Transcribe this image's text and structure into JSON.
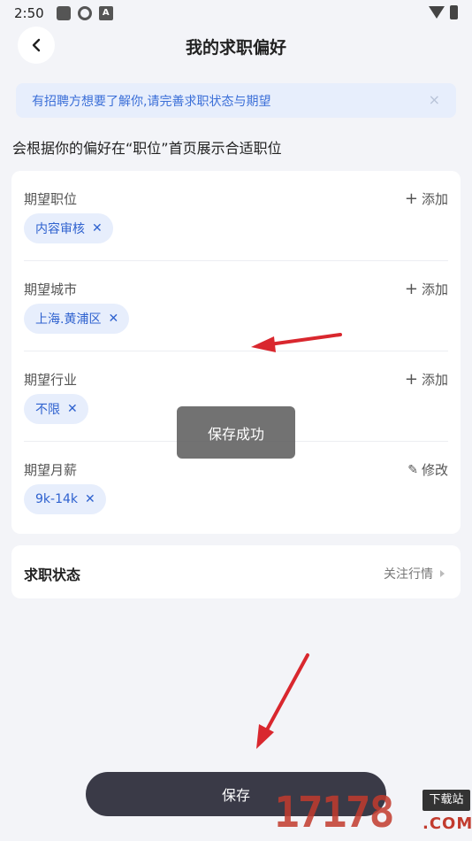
{
  "status_bar": {
    "time": "2:50",
    "a_badge": "A"
  },
  "header": {
    "title": "我的求职偏好"
  },
  "notice": {
    "text": "有招聘方想要了解你,请完善求职状态与期望",
    "close": "×"
  },
  "subtitle": "会根据你的偏好在“职位”首页展示合适职位",
  "sections": [
    {
      "label": "期望职位",
      "action": "添加",
      "tag": "内容审核"
    },
    {
      "label": "期望城市",
      "action": "添加",
      "tag": "上海.黄浦区"
    },
    {
      "label": "期望行业",
      "action": "添加",
      "tag": "不限"
    },
    {
      "label": "期望月薪",
      "action": "修改",
      "tag": "9k-14k"
    }
  ],
  "job_status": {
    "label": "求职状态",
    "value": "关注行情"
  },
  "toast": "保存成功",
  "save_label": "保存",
  "watermark": {
    "number": "17178",
    "badge": "下载站",
    "domain": ".COM"
  },
  "colors": {
    "accent": "#2f62cf",
    "tag_bg": "#e7eefc",
    "button": "#3a3a47",
    "arrow": "#d9272e"
  }
}
